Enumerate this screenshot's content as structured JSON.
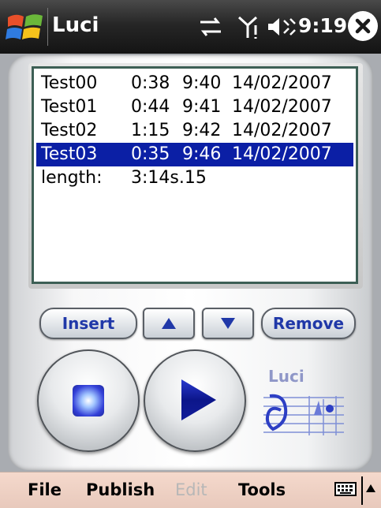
{
  "title_bar": {
    "app_title": "Luci",
    "clock": "9:19"
  },
  "playlist": {
    "rows": [
      {
        "name": "Test00",
        "duration": "0:38",
        "time": "9:40",
        "date": "14/02/2007",
        "selected": false
      },
      {
        "name": "Test01",
        "duration": "0:44",
        "time": "9:41",
        "date": "14/02/2007",
        "selected": false
      },
      {
        "name": "Test02",
        "duration": "1:15",
        "time": "9:42",
        "date": "14/02/2007",
        "selected": false
      },
      {
        "name": "Test03",
        "duration": "0:35",
        "time": "9:46",
        "date": "14/02/2007",
        "selected": true
      }
    ],
    "total_label": "length:",
    "total_value": "3:14s.15"
  },
  "controls": {
    "insert_label": "Insert",
    "remove_label": "Remove"
  },
  "logo": {
    "text": "Luci"
  },
  "menu": {
    "file": "File",
    "publish": "Publish",
    "edit": "Edit",
    "tools": "Tools"
  },
  "colors": {
    "selection": "#0b1fa5",
    "button_text": "#2038a8",
    "menu_bar": "#f0d3c6",
    "list_border": "#3d5f55"
  },
  "icons": [
    "windows-start-icon",
    "sync-icon",
    "signal-icon",
    "volume-icon",
    "close-icon",
    "up-arrow-icon",
    "down-arrow-icon",
    "stop-icon",
    "play-icon",
    "keyboard-icon",
    "arrow-up-icon"
  ]
}
